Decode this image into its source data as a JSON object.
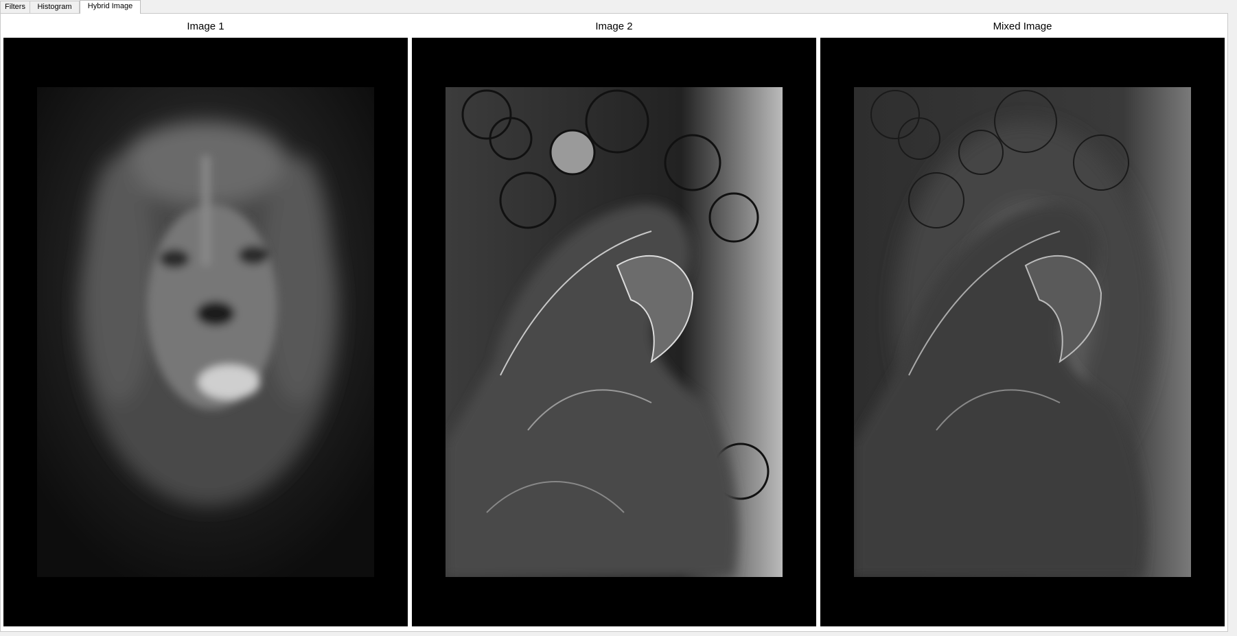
{
  "tabs": [
    {
      "label": "Filters",
      "active": false
    },
    {
      "label": "Histogram",
      "active": false
    },
    {
      "label": "Hybrid Image",
      "active": true
    }
  ],
  "panels": [
    {
      "title": "Image 1",
      "image": "lion-low-pass-image"
    },
    {
      "title": "Image 2",
      "image": "parrot-high-pass-image"
    },
    {
      "title": "Mixed Image",
      "image": "hybrid-lion-parrot-image"
    }
  ],
  "colors": {
    "panel_background": "#000000",
    "window_background": "#f0f0f0",
    "content_background": "#ffffff"
  }
}
